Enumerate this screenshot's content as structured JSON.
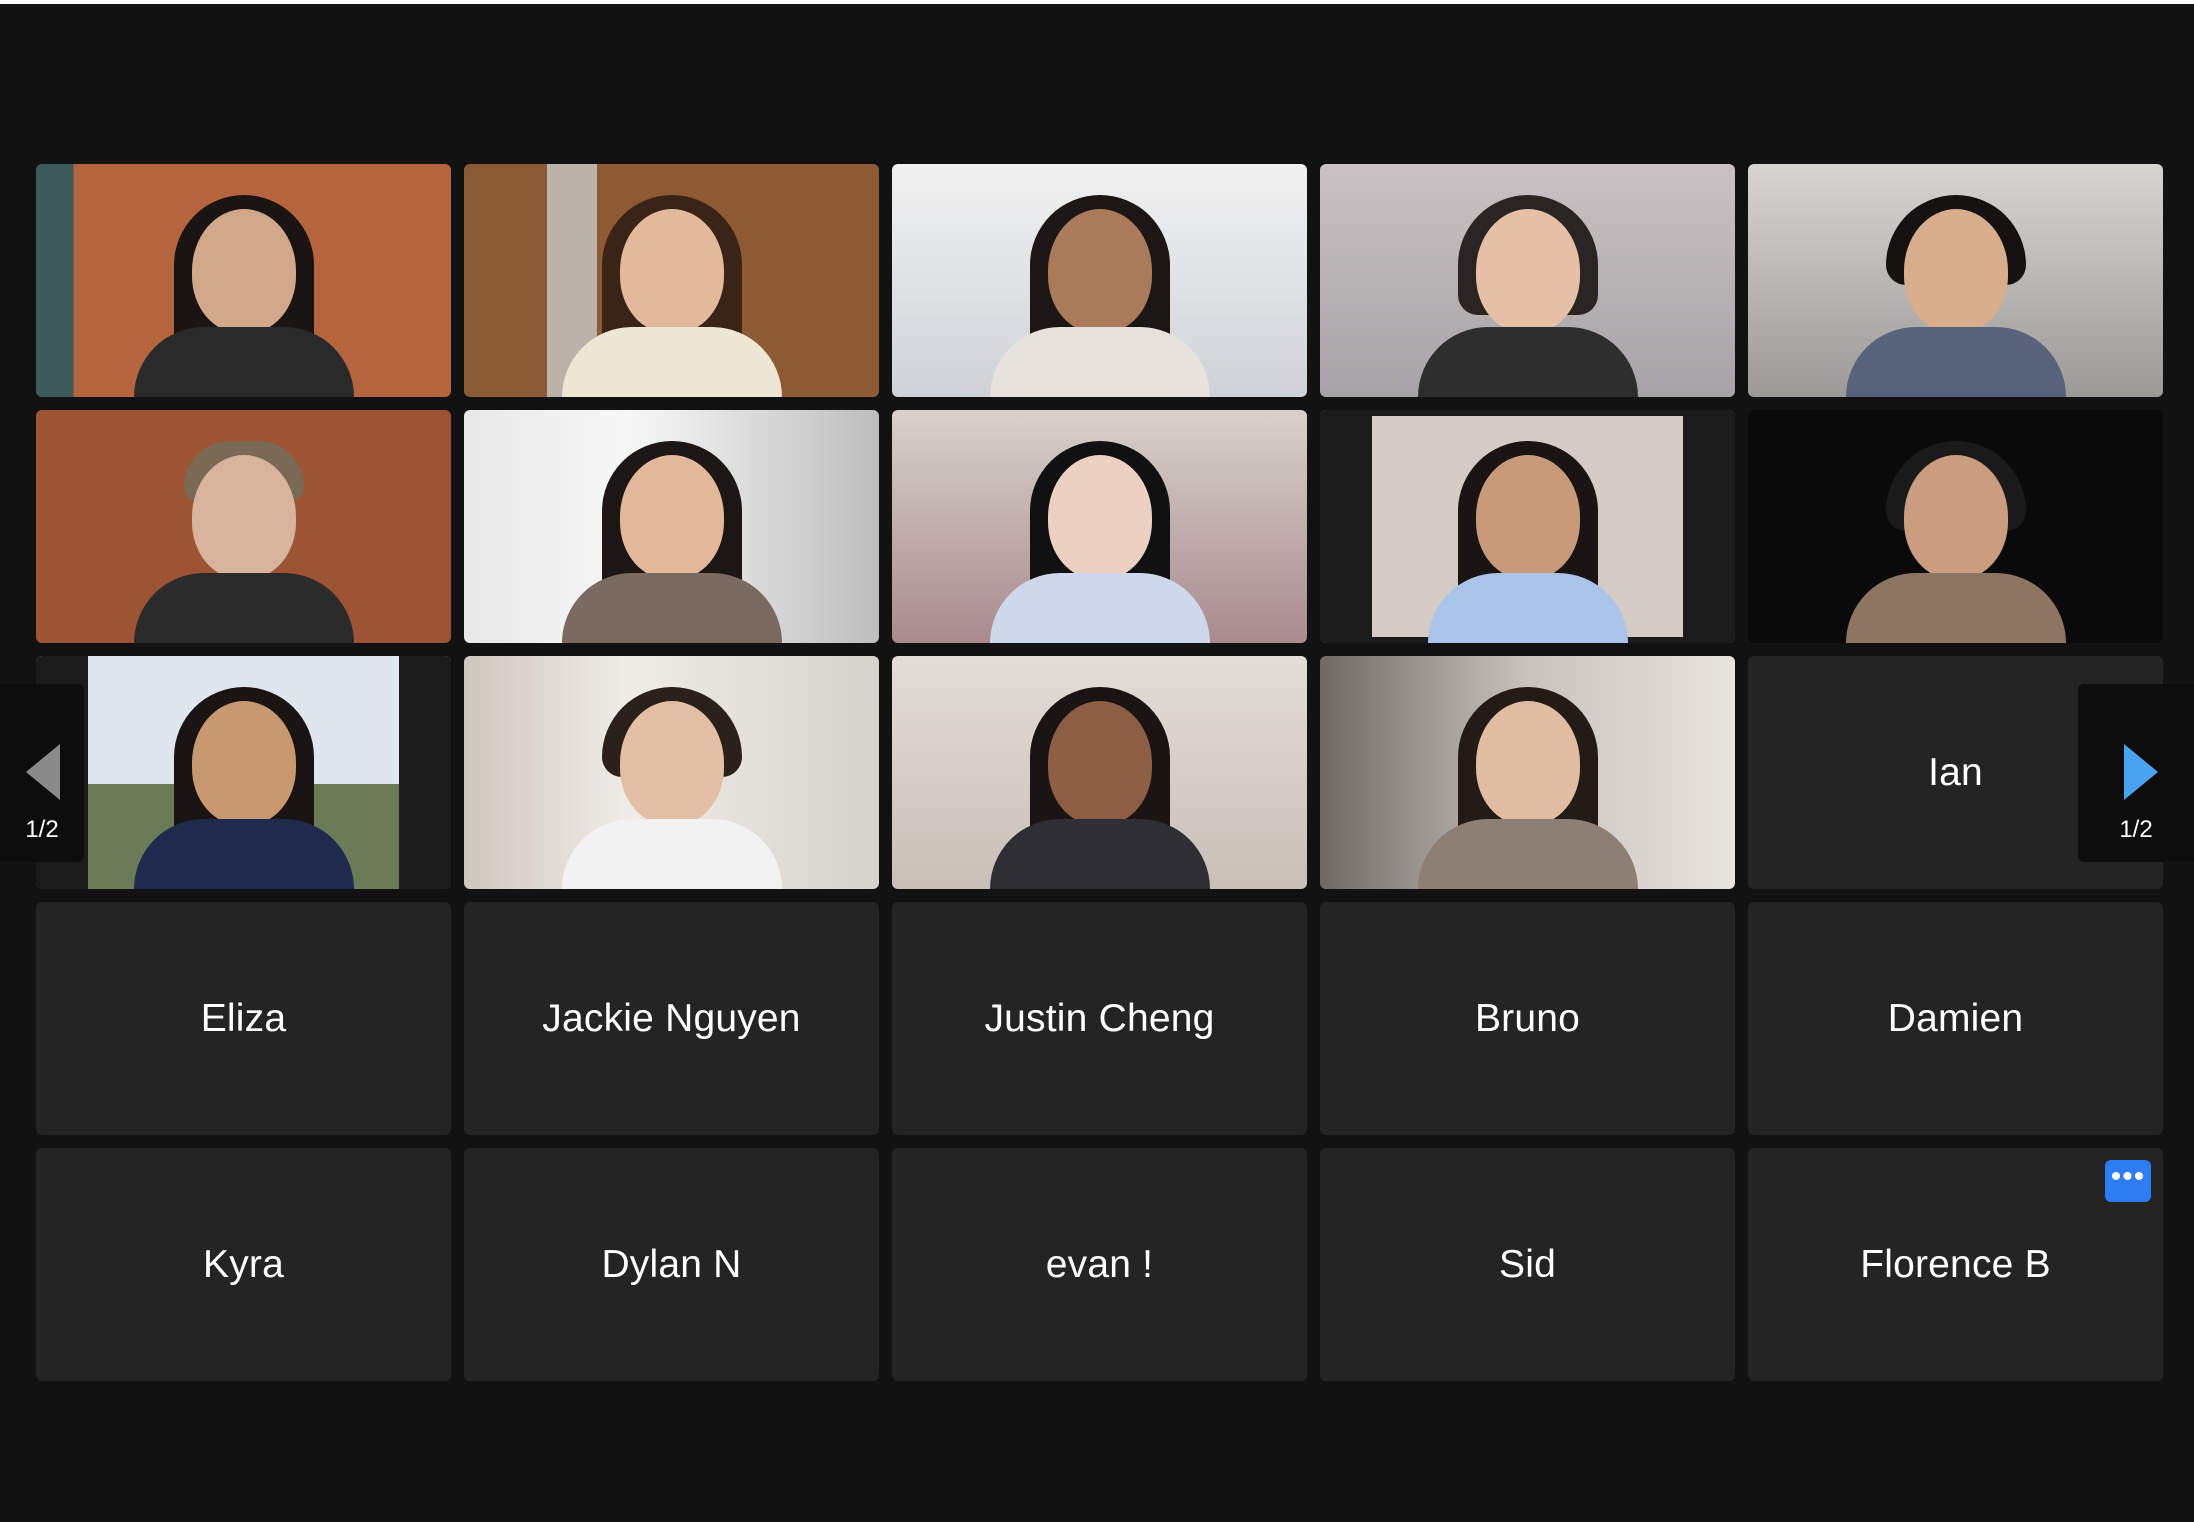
{
  "colors": {
    "background": "#121212",
    "tile": "#242424",
    "active_speaker_border": "#45c545",
    "more_button": "#2d7cf2",
    "next_arrow": "#4aa3f0",
    "prev_arrow": "#8a8a8a"
  },
  "video_tiles": [
    {
      "id": "video-1"
    },
    {
      "id": "video-2"
    },
    {
      "id": "video-3"
    },
    {
      "id": "video-4"
    },
    {
      "id": "video-5"
    },
    {
      "id": "video-6"
    },
    {
      "id": "video-7"
    },
    {
      "id": "video-8"
    },
    {
      "id": "video-9",
      "active_speaker": true
    },
    {
      "id": "video-10"
    },
    {
      "id": "video-11"
    },
    {
      "id": "video-12"
    },
    {
      "id": "video-13"
    },
    {
      "id": "video-14"
    }
  ],
  "participants": {
    "ian": "Ian",
    "eliza": "Eliza",
    "jackie": "Jackie Nguyen",
    "justin": "Justin Cheng",
    "bruno": "Bruno",
    "damien": "Damien",
    "kyra": "Kyra",
    "dylan": "Dylan N",
    "evan": "evan !",
    "sid": "Sid",
    "florence": "Florence B"
  },
  "pager": {
    "left_count": "1/2",
    "right_count": "1/2"
  },
  "more_button": {
    "label": "•••",
    "icon": "more-horizontal-icon"
  }
}
